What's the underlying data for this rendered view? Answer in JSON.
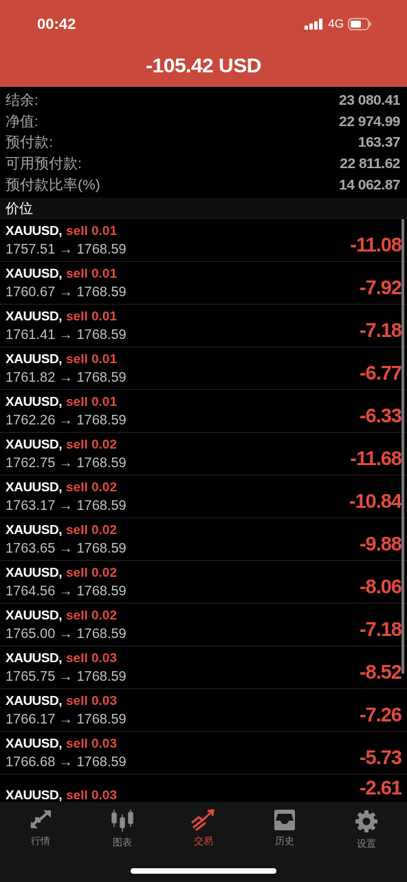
{
  "status_bar": {
    "time": "00:42",
    "network": "4G"
  },
  "header": {
    "title": "-105.42 USD"
  },
  "summary": [
    {
      "label": "结余:",
      "value": "23 080.41"
    },
    {
      "label": "净值:",
      "value": "22 974.99"
    },
    {
      "label": "预付款:",
      "value": "163.37"
    },
    {
      "label": "可用预付款:",
      "value": "22 811.62"
    },
    {
      "label": "预付款比率(%)",
      "value": "14 062.87"
    }
  ],
  "section_title": "价位",
  "positions": [
    {
      "symbol": "XAUUSD,",
      "order": "sell 0.01",
      "prices": "1757.51 → 1768.59",
      "profit": "-11.08"
    },
    {
      "symbol": "XAUUSD,",
      "order": "sell 0.01",
      "prices": "1760.67 → 1768.59",
      "profit": "-7.92"
    },
    {
      "symbol": "XAUUSD,",
      "order": "sell 0.01",
      "prices": "1761.41 → 1768.59",
      "profit": "-7.18"
    },
    {
      "symbol": "XAUUSD,",
      "order": "sell 0.01",
      "prices": "1761.82 → 1768.59",
      "profit": "-6.77"
    },
    {
      "symbol": "XAUUSD,",
      "order": "sell 0.01",
      "prices": "1762.26 → 1768.59",
      "profit": "-6.33"
    },
    {
      "symbol": "XAUUSD,",
      "order": "sell 0.02",
      "prices": "1762.75 → 1768.59",
      "profit": "-11.68"
    },
    {
      "symbol": "XAUUSD,",
      "order": "sell 0.02",
      "prices": "1763.17 → 1768.59",
      "profit": "-10.84"
    },
    {
      "symbol": "XAUUSD,",
      "order": "sell 0.02",
      "prices": "1763.65 → 1768.59",
      "profit": "-9.88"
    },
    {
      "symbol": "XAUUSD,",
      "order": "sell 0.02",
      "prices": "1764.56 → 1768.59",
      "profit": "-8.06"
    },
    {
      "symbol": "XAUUSD,",
      "order": "sell 0.02",
      "prices": "1765.00 → 1768.59",
      "profit": "-7.18"
    },
    {
      "symbol": "XAUUSD,",
      "order": "sell 0.03",
      "prices": "1765.75 → 1768.59",
      "profit": "-8.52"
    },
    {
      "symbol": "XAUUSD,",
      "order": "sell 0.03",
      "prices": "1766.17 → 1768.59",
      "profit": "-7.26"
    },
    {
      "symbol": "XAUUSD,",
      "order": "sell 0.03",
      "prices": "1766.68 → 1768.59",
      "profit": "-5.73"
    },
    {
      "symbol": "XAUUSD,",
      "order": "sell 0.03",
      "profit": "-2.61"
    }
  ],
  "tabs": [
    {
      "kind": "quotes",
      "label": "行情",
      "selected": false
    },
    {
      "kind": "chart",
      "label": "图表",
      "selected": false
    },
    {
      "kind": "trade",
      "label": "交易",
      "selected": true
    },
    {
      "kind": "history",
      "label": "历史",
      "selected": false
    },
    {
      "kind": "settings",
      "label": "设置",
      "selected": false
    }
  ]
}
